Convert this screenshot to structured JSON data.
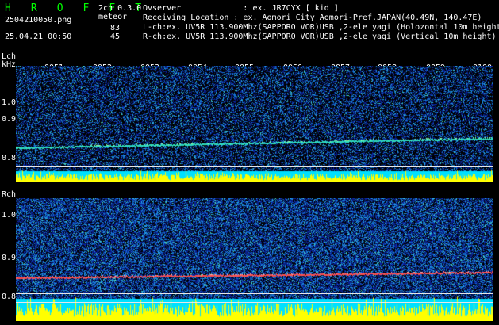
{
  "header": {
    "brand": "H R O F F T",
    "mode": "2ch 0.3.0",
    "filename": "2504210050.png",
    "meteor_label": "meteor",
    "datetime": "25.04.21 00:50",
    "l_count": "83",
    "r_count": "45",
    "observer": "Ovserver             : ex. JR7CYX [ kid ]",
    "location": "Receiving Location : ex. Aomori City Aomori-Pref.JAPAN(40.49N, 140.47E)",
    "lch_info": "L-ch:ex. UV5R 113.900Mhz(SAPPORO VOR)USB ,2-ele yagi (Holozontal 10m height",
    "rch_info": "R-ch:ex. UV5R 113.900Mhz(SAPPORO VOR)USB ,2-ele yagi (Vertical 10m height)"
  },
  "lch": {
    "label": "Lch",
    "unit": "kHz",
    "yticks": [
      "1.0",
      "0.9",
      "0.8"
    ],
    "time_ticks": [
      "0051",
      "0052",
      "0053",
      "0054",
      "0055",
      "0056",
      "0057",
      "0058",
      "0059",
      "0100"
    ]
  },
  "rch": {
    "label": "Rch",
    "yticks": [
      "1.0",
      "0.9",
      "0.8"
    ]
  },
  "colors": {
    "background": "#000000",
    "noise": "#1030a0",
    "signal_l": "#30e0c0",
    "signal_r": "#ff5050",
    "bar_cyan": "#00e0ff",
    "bar_yellow": "#ffff00",
    "brand": "#00ff00"
  }
}
